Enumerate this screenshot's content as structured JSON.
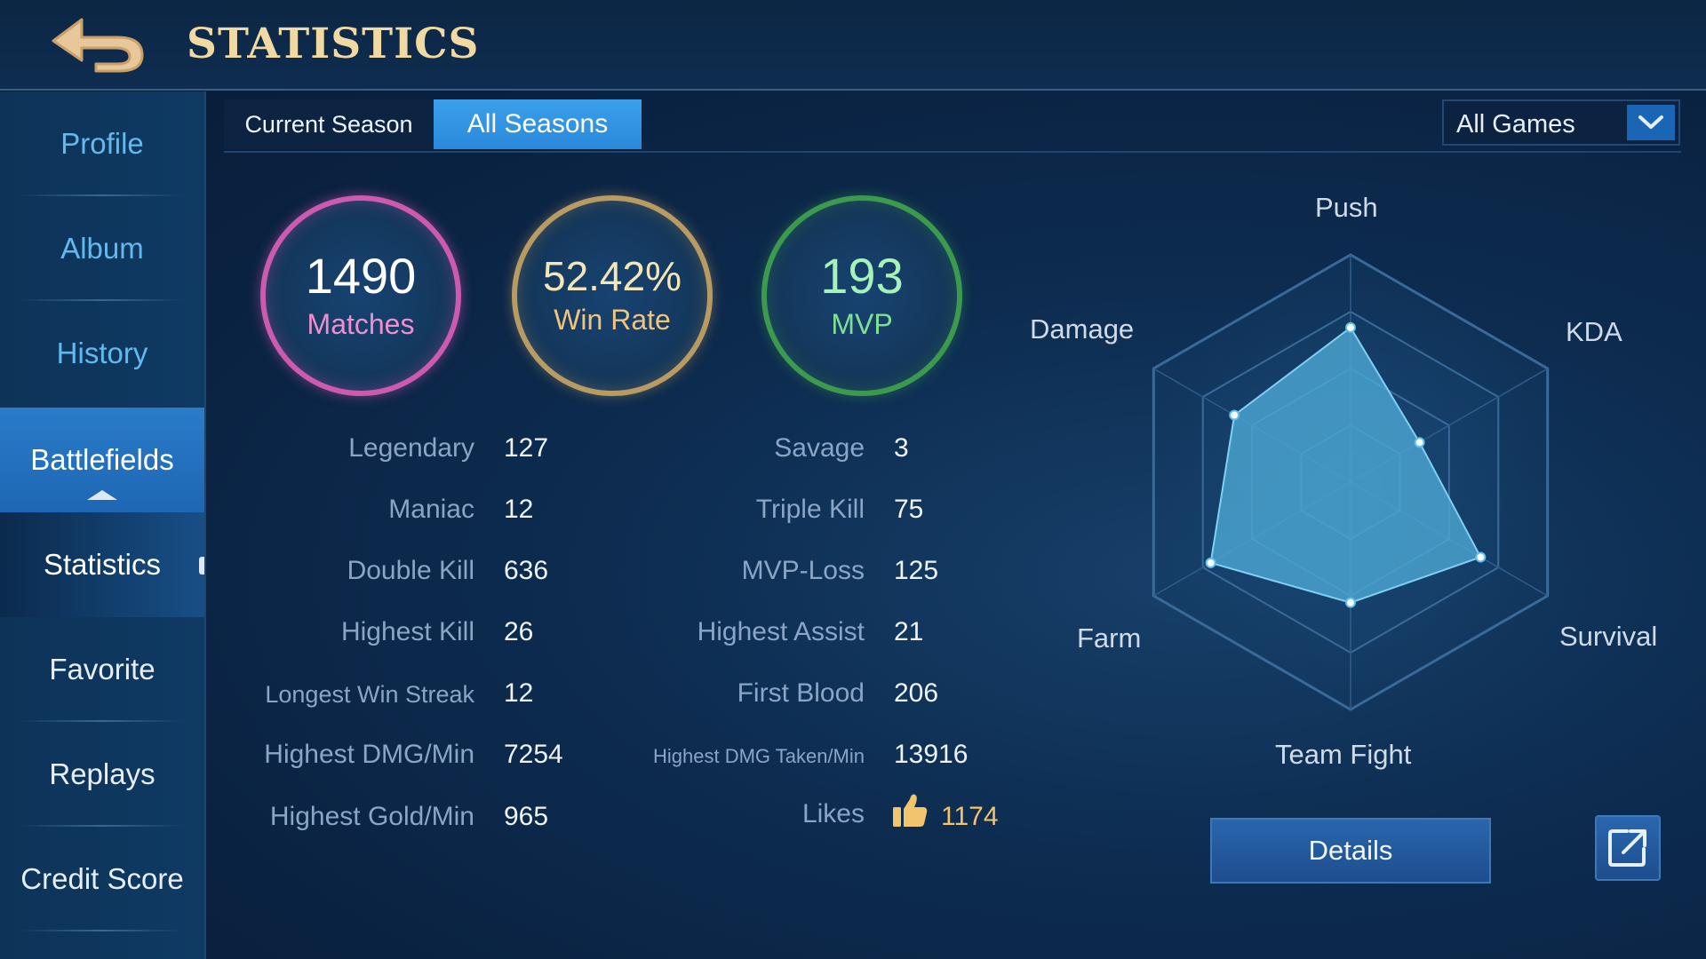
{
  "header": {
    "title": "STATISTICS",
    "back_icon": "back-arrow-icon"
  },
  "sidebar": {
    "items": [
      {
        "label": "Profile"
      },
      {
        "label": "Album"
      },
      {
        "label": "History"
      },
      {
        "label": "Battlefields"
      },
      {
        "label": "Statistics"
      },
      {
        "label": "Favorite"
      },
      {
        "label": "Replays"
      },
      {
        "label": "Credit Score"
      }
    ]
  },
  "tabs": {
    "current": "Current Season",
    "all": "All Seasons",
    "selected": "All Seasons"
  },
  "filter": {
    "value": "All Games",
    "icon": "chevron-down-icon"
  },
  "summary": {
    "matches": {
      "value": "1490",
      "label": "Matches",
      "color": "#cc5aaf"
    },
    "win_rate": {
      "value": "52.42%",
      "label": "Win Rate",
      "color": "#b89a63"
    },
    "mvp": {
      "value": "193",
      "label": "MVP",
      "color": "#3b9a4e"
    }
  },
  "stats_left": [
    {
      "label": "Legendary",
      "value": "127"
    },
    {
      "label": "Maniac",
      "value": "12"
    },
    {
      "label": "Double Kill",
      "value": "636"
    },
    {
      "label": "Highest Kill",
      "value": "26"
    },
    {
      "label": "Longest Win Streak",
      "value": "12"
    },
    {
      "label": "Highest DMG/Min",
      "value": "7254"
    },
    {
      "label": "Highest Gold/Min",
      "value": "965"
    }
  ],
  "stats_right": [
    {
      "label": "Savage",
      "value": "3"
    },
    {
      "label": "Triple Kill",
      "value": "75"
    },
    {
      "label": "MVP-Loss",
      "value": "125"
    },
    {
      "label": "Highest Assist",
      "value": "21"
    },
    {
      "label": "First Blood",
      "value": "206"
    },
    {
      "label": "Highest DMG Taken/Min",
      "value": "13916"
    },
    {
      "label": "Likes",
      "value": "1174",
      "icon": "thumbs-up-icon"
    }
  ],
  "chart_data": {
    "type": "radar",
    "axes": [
      "Push",
      "KDA",
      "Survival",
      "Team Fight",
      "Farm",
      "Damage"
    ],
    "values": [
      0.68,
      0.35,
      0.66,
      0.53,
      0.71,
      0.59
    ],
    "range": [
      0,
      1
    ],
    "fill_color": "#4eaad6"
  },
  "actions": {
    "details": "Details",
    "share_icon": "share-external-icon"
  }
}
